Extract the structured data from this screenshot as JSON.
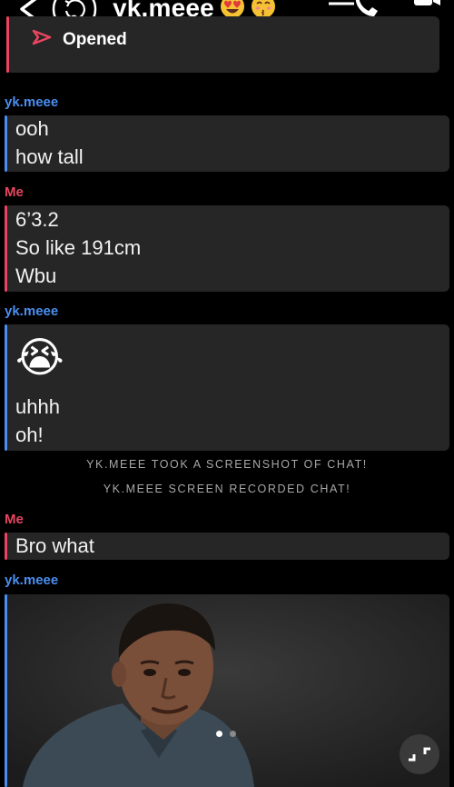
{
  "header": {
    "contact_name": "yk.meee",
    "name_emojis": [
      "heart-eyes",
      "kissing-face"
    ]
  },
  "messages": [
    {
      "status": "Opened"
    },
    {
      "sender": "yk.meee",
      "lines": [
        "ooh",
        "how tall"
      ]
    },
    {
      "sender": "Me",
      "lines": [
        "6’3.2",
        "So like 191cm",
        "Wbu"
      ]
    },
    {
      "sender": "yk.meee",
      "lines": [
        "😭",
        "uhhh",
        "oh!"
      ]
    },
    {
      "sender": "Me",
      "lines": [
        "Bro what"
      ]
    },
    {
      "sender": "yk.meee"
    }
  ],
  "system_notices": [
    "YK.MEEE TOOK A SCREENSHOT OF CHAT!",
    "YK.MEEE SCREEN RECORDED CHAT!"
  ],
  "media": {
    "pager": {
      "count": 2,
      "active": 1
    }
  },
  "colors": {
    "me": "#e94560",
    "them": "#4a8ef0",
    "bubble": "#262626",
    "background": "#000000",
    "system_text": "#a8a8a8"
  }
}
